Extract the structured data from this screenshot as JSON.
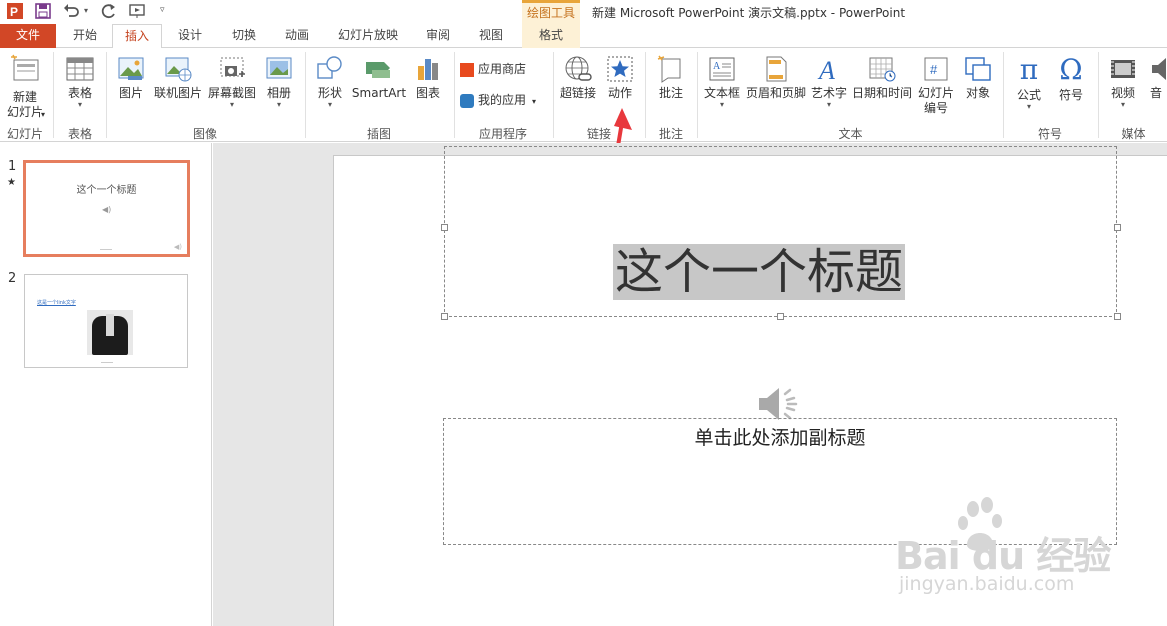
{
  "window": {
    "title": "新建 Microsoft PowerPoint 演示文稿.pptx - PowerPoint",
    "context_group": "绘图工具"
  },
  "tabs": [
    "文件",
    "开始",
    "插入",
    "设计",
    "切换",
    "动画",
    "幻灯片放映",
    "审阅",
    "视图",
    "格式"
  ],
  "ribbon": {
    "new_slide": "新建\n幻灯片",
    "table": "表格",
    "picture": "图片",
    "online_picture": "联机图片",
    "screenshot": "屏幕截图",
    "album": "相册",
    "shapes": "形状",
    "smartart": "SmartArt",
    "chart": "图表",
    "store": "应用商店",
    "my_apps": "我的应用",
    "hyperlink": "超链接",
    "action": "动作",
    "comment": "批注",
    "textbox": "文本框",
    "header_footer": "页眉和页脚",
    "wordart": "艺术字",
    "datetime": "日期和时间",
    "slide_number": "幻灯片\n编号",
    "object": "对象",
    "equation": "公式",
    "symbol": "符号",
    "video": "视频",
    "audio": "音",
    "groups": {
      "slides": "幻灯片",
      "tables": "表格",
      "images": "图像",
      "illustrations": "插图",
      "apps": "应用程序",
      "links": "链接",
      "comments": "批注",
      "text": "文本",
      "symbols": "符号",
      "media": "媒体"
    }
  },
  "thumbnails": [
    {
      "number": "1",
      "title": "这个一个标题"
    },
    {
      "number": "2",
      "link_text": "这是一个link文字"
    }
  ],
  "slide": {
    "title": "这个一个标题",
    "subtitle": "单击此处添加副标题"
  },
  "watermark": {
    "brand": "Bai du 经验",
    "url": "jingyan.baidu.com"
  },
  "colors": {
    "accent": "#d24726",
    "context_tab": "#fdf1d6",
    "arrow": "#e8383d"
  }
}
